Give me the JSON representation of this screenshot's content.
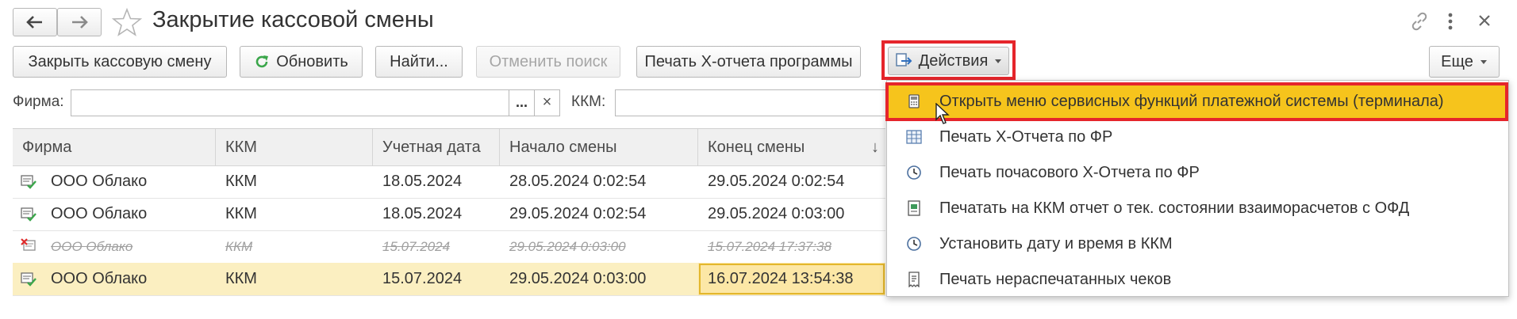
{
  "window": {
    "title": "Закрытие кассовой смены",
    "back_icon": "arrow-left-icon",
    "forward_icon": "arrow-right-icon",
    "favorite_icon": "star-icon",
    "link_icon": "link-icon",
    "more_icon": "kebab-icon",
    "close_icon": "close-icon"
  },
  "toolbar": {
    "close_shift": "Закрыть кассовую смену",
    "refresh": "Обновить",
    "find": "Найти...",
    "cancel_search": "Отменить поиск",
    "print_x_report": "Печать X-отчета программы",
    "actions": "Действия",
    "more": "Еще"
  },
  "filters": {
    "firm_label": "Фирма:",
    "firm_value": "",
    "select_button": "...",
    "clear_button": "×",
    "kkm_label": "ККМ:",
    "kkm_value": ""
  },
  "table": {
    "columns": [
      "Фирма",
      "ККМ",
      "Учетная дата",
      "Начало смены",
      "Конец смены"
    ],
    "sort_indicator": "↓",
    "rows": [
      {
        "firm": "ООО Облако",
        "kkm": "ККМ",
        "date": "18.05.2024",
        "start": "28.05.2024 0:02:54",
        "end": "29.05.2024 0:02:54",
        "status": "closed"
      },
      {
        "firm": "ООО Облако",
        "kkm": "ККМ",
        "date": "18.05.2024",
        "start": "29.05.2024 0:02:54",
        "end": "29.05.2024 0:03:00",
        "status": "closed"
      },
      {
        "firm": "ООО Облако",
        "kkm": "ККМ",
        "date": "15.07.2024",
        "start": "29.05.2024 0:03:00",
        "end": "15.07.2024 17:37:38",
        "status": "deleted"
      },
      {
        "firm": "ООО Облако",
        "kkm": "ККМ",
        "date": "15.07.2024",
        "start": "29.05.2024 0:03:00",
        "end": "16.07.2024 13:54:38",
        "status": "selected"
      }
    ]
  },
  "actions_menu": {
    "items": [
      {
        "label": "Открыть меню сервисных функций платежной системы (терминала)",
        "icon": "terminal-icon",
        "highlighted": true
      },
      {
        "label": "Печать X-Отчета по ФР",
        "icon": "table-icon"
      },
      {
        "label": "Печать почасового X-Отчета по ФР",
        "icon": "clock-icon"
      },
      {
        "label": "Печатать на ККМ отчет о тек. состоянии взаиморасчетов с ОФД",
        "icon": "document-icon"
      },
      {
        "label": "Установить дату и время в ККМ",
        "icon": "clock-icon"
      },
      {
        "label": "Печать нераспечатанных чеков",
        "icon": "receipt-icon"
      }
    ]
  },
  "colors": {
    "highlight_border": "#e5252b",
    "menu_highlight": "#f6c41c",
    "selected_row": "#fbefc1",
    "refresh_icon": "#3aa64a"
  }
}
